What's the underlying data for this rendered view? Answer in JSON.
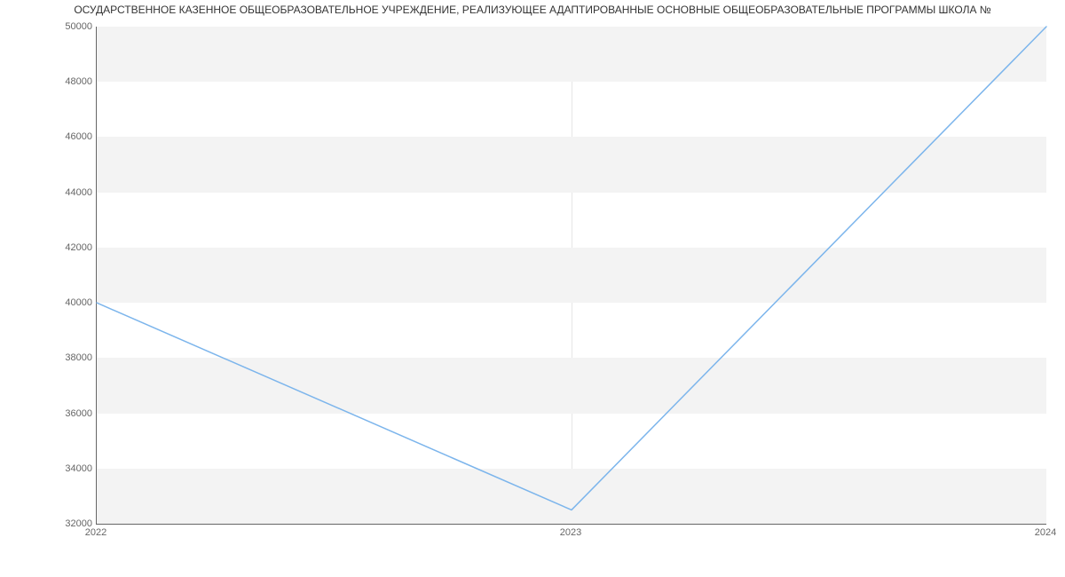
{
  "chart_data": {
    "type": "line",
    "title": "ОСУДАРСТВЕННОЕ КАЗЕННОЕ ОБЩЕОБРАЗОВАТЕЛЬНОЕ УЧРЕЖДЕНИЕ, РЕАЛИЗУЮЩЕЕ АДАПТИРОВАННЫЕ ОСНОВНЫЕ ОБЩЕОБРАЗОВАТЕЛЬНЫЕ ПРОГРАММЫ ШКОЛА №",
    "x": [
      2022,
      2023,
      2024
    ],
    "values": [
      40000,
      32500,
      50000
    ],
    "xticks": [
      2022,
      2023,
      2024
    ],
    "yticks": [
      32000,
      34000,
      36000,
      38000,
      40000,
      42000,
      44000,
      46000,
      48000,
      50000
    ],
    "ylim": [
      32000,
      50000
    ],
    "xlim": [
      2022,
      2024
    ],
    "line_color": "#7cb5ec"
  }
}
